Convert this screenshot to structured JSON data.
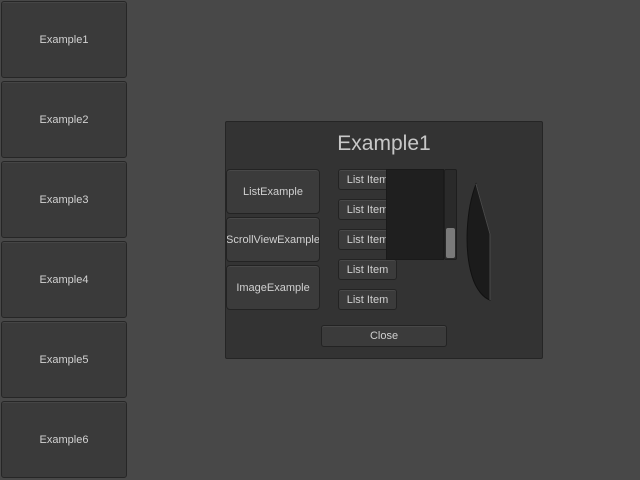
{
  "sidebar": {
    "items": [
      {
        "label": "Example1"
      },
      {
        "label": "Example2"
      },
      {
        "label": "Example3"
      },
      {
        "label": "Example4"
      },
      {
        "label": "Example5"
      },
      {
        "label": "Example6"
      }
    ]
  },
  "dialog": {
    "title": "Example1",
    "tabs": [
      {
        "label": "ListExample"
      },
      {
        "label": "ScrollViewExample"
      },
      {
        "label": "ImageExample"
      }
    ],
    "list_items": [
      {
        "label": "List Item"
      },
      {
        "label": "List Item"
      },
      {
        "label": "List Item"
      },
      {
        "label": "List Item"
      },
      {
        "label": "List Item"
      }
    ],
    "close_label": "Close"
  },
  "colors": {
    "background": "#484848",
    "panel": "#333333",
    "button": "#3b3b3b",
    "text": "#d0d0d0"
  }
}
